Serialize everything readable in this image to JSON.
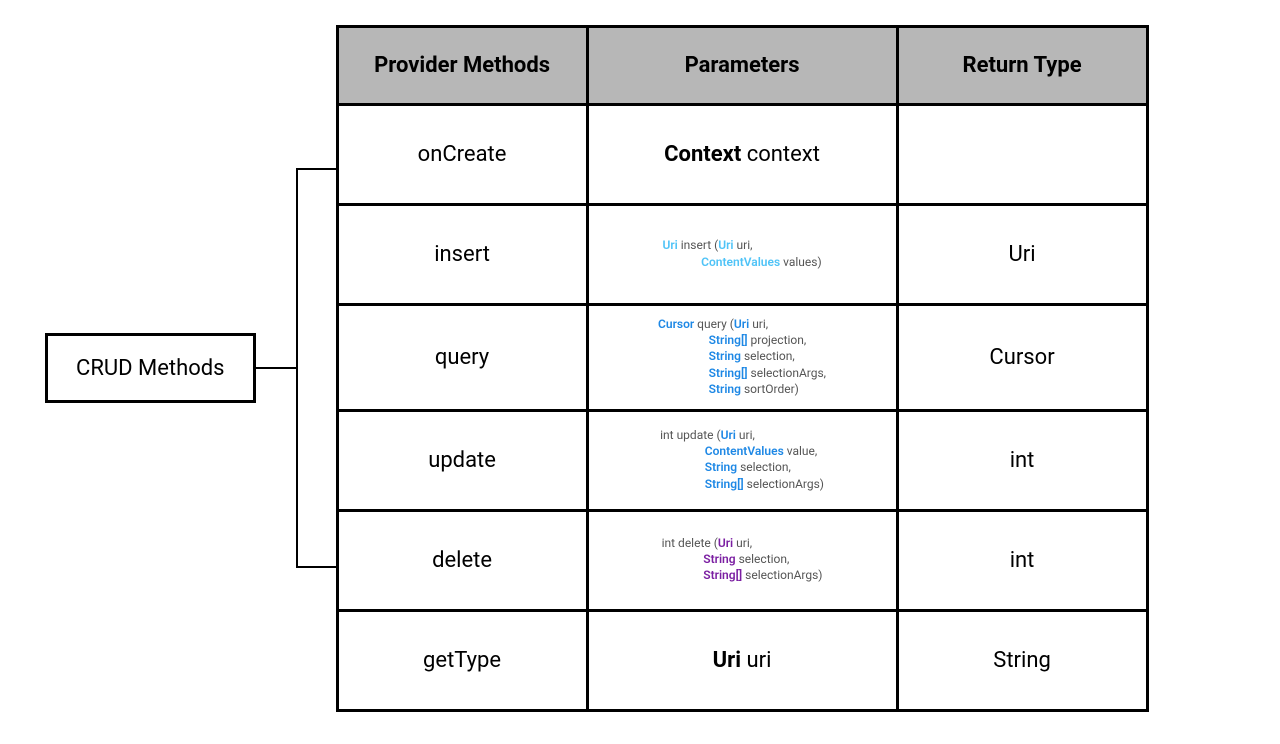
{
  "label_box": "CRUD Methods",
  "headers": {
    "methods": "Provider Methods",
    "params": "Parameters",
    "return": "Return Type"
  },
  "rows": {
    "onCreate": {
      "method": "onCreate",
      "param_bold": "Context",
      "param_plain": " context",
      "return": ""
    },
    "insert": {
      "method": "insert",
      "return": "Uri",
      "sig": {
        "ret": "Uri",
        "name": " insert (",
        "p1t": "Uri",
        "p1n": " uri,",
        "p2t": "ContentValues",
        "p2n": " values)"
      }
    },
    "query": {
      "method": "query",
      "return": "Cursor",
      "sig": {
        "ret": "Cursor",
        "name": " query (",
        "p1t": "Uri",
        "p1n": " uri,",
        "p2t": "String[]",
        "p2n": " projection,",
        "p3t": "String",
        "p3n": " selection,",
        "p4t": "String[]",
        "p4n": " selectionArgs,",
        "p5t": "String",
        "p5n": " sortOrder)"
      }
    },
    "update": {
      "method": "update",
      "return": "int",
      "sig": {
        "ret": "int",
        "name": " update (",
        "p1t": "Uri",
        "p1n": " uri,",
        "p2t": "ContentValues",
        "p2n": " value,",
        "p3t": "String",
        "p3n": " selection,",
        "p4t": "String[]",
        "p4n": " selectionArgs)"
      }
    },
    "delete": {
      "method": "delete",
      "return": "int",
      "sig": {
        "ret": "int",
        "name": " delete (",
        "p1t": "Uri",
        "p1n": " uri,",
        "p2t": "String",
        "p2n": " selection,",
        "p3t": "String[]",
        "p3n": " selectionArgs)"
      }
    },
    "getType": {
      "method": "getType",
      "param_bold": "Uri",
      "param_plain": " uri",
      "return": "String"
    }
  },
  "colors": {
    "cyan": "#4fc3f7",
    "blue": "#1e88e5",
    "purple": "#7b1fa2"
  }
}
